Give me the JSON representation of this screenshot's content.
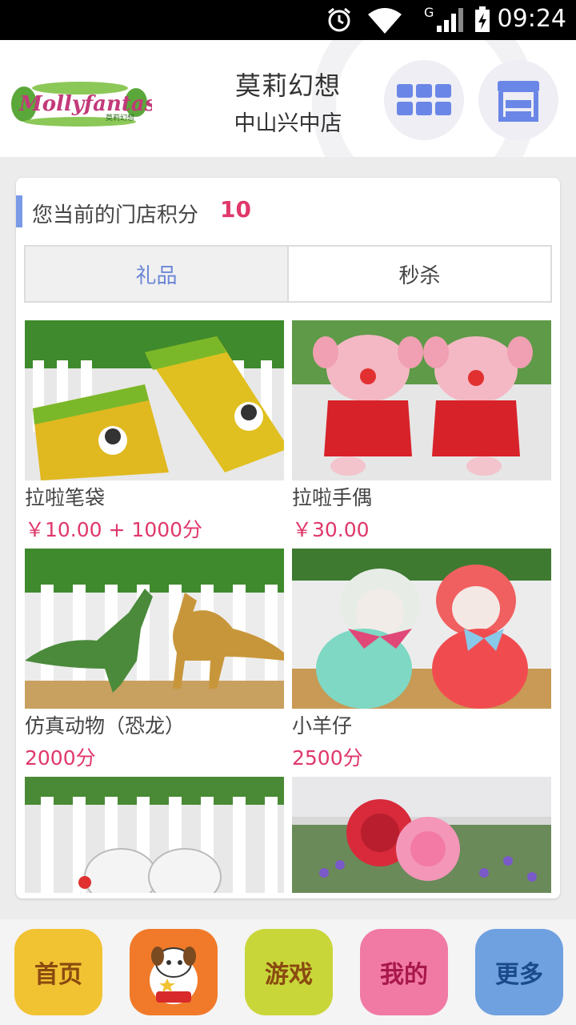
{
  "status_bar": {
    "time": "09:24",
    "signal_label": "G"
  },
  "header": {
    "brand_logo_text": "Mollyfantasy",
    "brand_logo_sub": "莫莉幻想",
    "title": "莫莉幻想",
    "subtitle": "中山兴中店"
  },
  "points": {
    "label": "您当前的门店积分",
    "value": "10"
  },
  "tabs": [
    {
      "label": "礼品",
      "active": true
    },
    {
      "label": "秒杀",
      "active": false
    }
  ],
  "products": [
    {
      "name": "拉啦笔袋",
      "price": "￥10.00 + 1000分"
    },
    {
      "name": "拉啦手偶",
      "price": "￥30.00"
    },
    {
      "name": "仿真动物（恐龙）",
      "price": "2000分"
    },
    {
      "name": "小羊仔",
      "price": "2500分"
    },
    {
      "name": "",
      "price": ""
    },
    {
      "name": "",
      "price": ""
    }
  ],
  "bottom_nav": [
    {
      "label": "首页",
      "color": "#f1c232"
    },
    {
      "label": "",
      "color": "#f07a2a"
    },
    {
      "label": "游戏",
      "color": "#c9d63a"
    },
    {
      "label": "我的",
      "color": "#f07aa4"
    },
    {
      "label": "更多",
      "color": "#6fa0e0"
    }
  ],
  "colors": {
    "accent_pink": "#e0386a",
    "accent_blue": "#6a86d6"
  }
}
